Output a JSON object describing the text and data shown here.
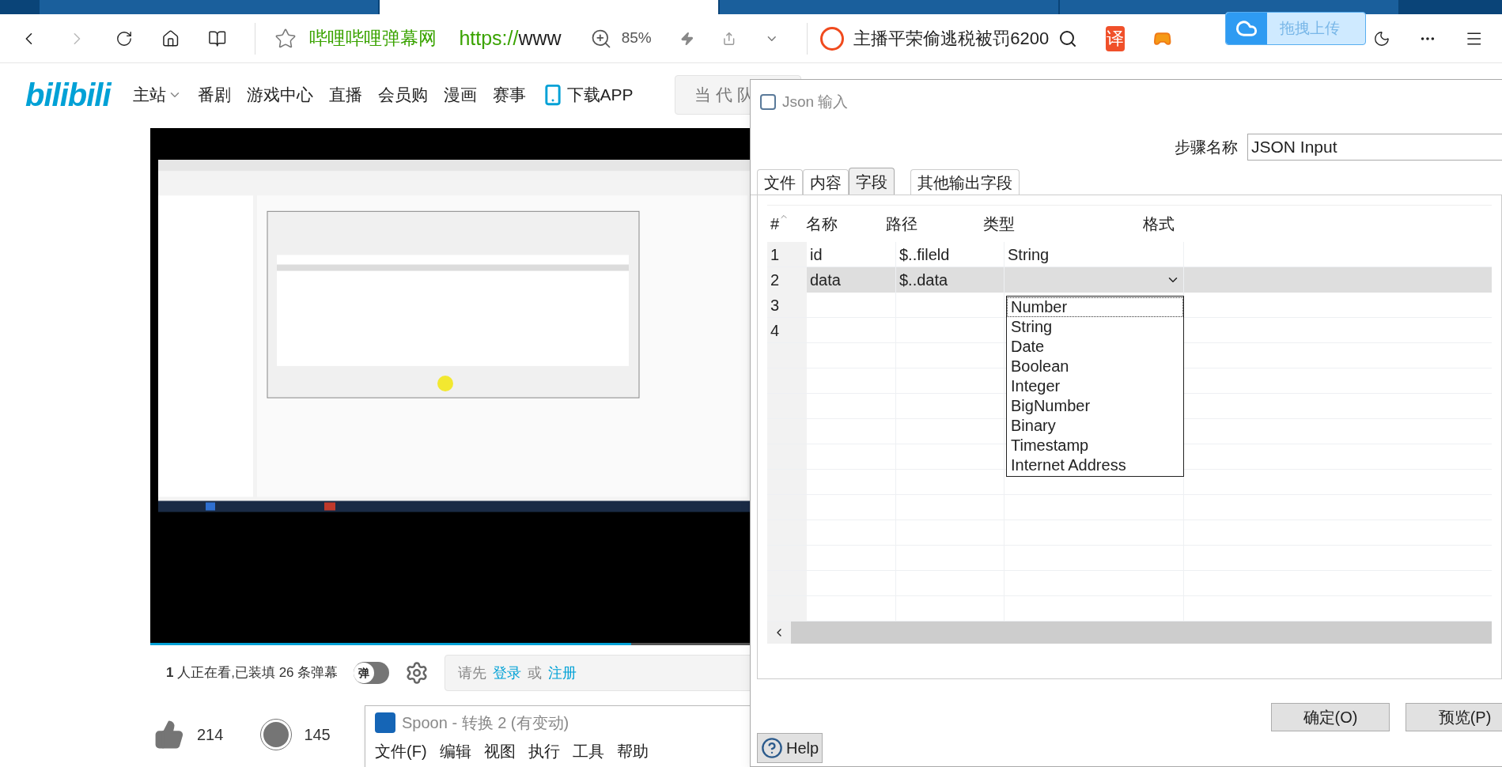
{
  "browser_tabs": [
    {
      "selected": false
    },
    {
      "selected": true
    },
    {
      "selected": false
    },
    {
      "selected": false
    }
  ],
  "toolbar": {
    "site_name": "哔哩哔哩弹幕网",
    "url_scheme": "https://",
    "url_rest": "www",
    "zoom": "85%",
    "search_query": "主播平荣偷逃税被罚6200",
    "translate_label": "译"
  },
  "upload_popup": {
    "label": "拖拽上传"
  },
  "site_nav": {
    "logo": "bilibili",
    "items": [
      {
        "label": "主站",
        "dropdown": true
      },
      {
        "label": "番剧",
        "dropdown": false
      },
      {
        "label": "游戏中心",
        "dropdown": false
      },
      {
        "label": "直播",
        "dropdown": false
      },
      {
        "label": "会员购",
        "dropdown": false
      },
      {
        "label": "漫画",
        "dropdown": false
      },
      {
        "label": "赛事",
        "dropdown": false
      }
    ],
    "download": "下载APP",
    "search_placeholder": "当代队"
  },
  "video": {
    "kind": "picture",
    "progress": {
      "level": 0.8
    }
  },
  "danmaku_bar": {
    "viewers_count": "1",
    "viewers_text": "人正在看,已装填 26 条弹幕",
    "toggle_label": "弹",
    "toggle_on": false,
    "prompt": "请先",
    "login": "登录",
    "or": "或",
    "register": "注册"
  },
  "reactions": [
    {
      "kind": "like",
      "count": "214"
    },
    {
      "kind": "coin",
      "count": "145"
    }
  ],
  "spoon_window": {
    "title": "Spoon - 转换 2 (有变动)",
    "menu": [
      "文件(F)",
      "编辑",
      "视图",
      "执行",
      "工具",
      "帮助"
    ]
  },
  "dialog": {
    "title": "Json 输入",
    "step_name_label": "步骤名称",
    "step_name": "JSON Input",
    "tabs": [
      {
        "label": "文件",
        "selected": false
      },
      {
        "label": "内容",
        "selected": false
      },
      {
        "label": "字段",
        "selected": true
      },
      {
        "label": "其他输出字段",
        "selected": false
      }
    ],
    "table": {
      "columns": [
        "#",
        "名称",
        "路径",
        "类型",
        "格式"
      ],
      "rows": [
        {
          "number": "1",
          "name": "id",
          "path": "$..fileld",
          "type": "String",
          "selected": false
        },
        {
          "number": "2",
          "name": "data",
          "path": "$..data",
          "type": "",
          "selected": true
        },
        {
          "number": "3",
          "name": "",
          "path": "",
          "type": "",
          "selected": false
        },
        {
          "number": "4",
          "name": "",
          "path": "",
          "type": "",
          "selected": false
        }
      ]
    },
    "type_options": [
      {
        "label": "Number",
        "selected": true
      },
      {
        "label": "String",
        "selected": false
      },
      {
        "label": "Date",
        "selected": false
      },
      {
        "label": "Boolean",
        "selected": false
      },
      {
        "label": "Integer",
        "selected": false
      },
      {
        "label": "BigNumber",
        "selected": false
      },
      {
        "label": "Binary",
        "selected": false
      },
      {
        "label": "Timestamp",
        "selected": false
      },
      {
        "label": "Internet Address",
        "selected": false
      }
    ],
    "buttons": [
      "确定(O)",
      "预览(P)"
    ],
    "help": "Help"
  }
}
